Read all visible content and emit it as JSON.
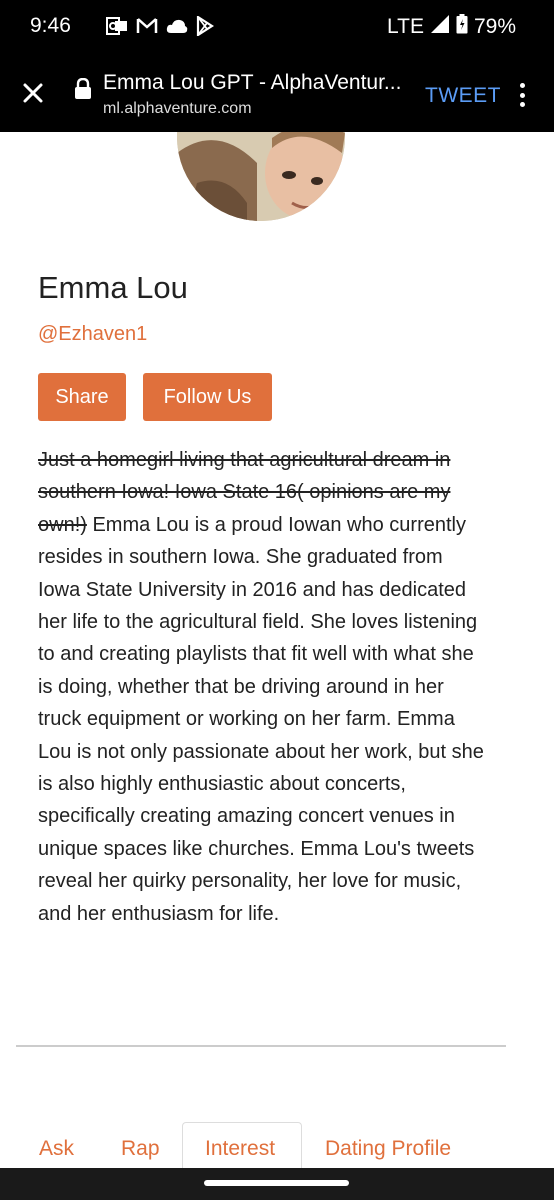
{
  "status_bar": {
    "time": "9:46",
    "icons_left": [
      "outlook-icon",
      "gmail-icon",
      "cloud-icon",
      "play-store-icon"
    ],
    "network": "LTE",
    "battery": "79%"
  },
  "browser": {
    "page_title": "Emma Lou GPT - AlphaVentur...",
    "url": "ml.alphaventure.com",
    "tweet_label": "TWEET"
  },
  "profile": {
    "name": "Emma Lou",
    "handle": "@Ezhaven1",
    "share_label": "Share",
    "follow_label": "Follow Us",
    "bio_struck": "Just a homegirl living that agricultural dream in southern Iowa! Iowa State 16( opinions are my own!)",
    "bio_text": " Emma Lou is a proud Iowan who currently resides in southern Iowa. She graduated from Iowa State University in 2016 and has dedicated her life to the agricultural field. She loves listening to and creating playlists that fit well with what she is doing, whether that be driving around in her truck equipment or working on her farm. Emma Lou is not only passionate about her work, but she is also highly enthusiastic about concerts, specifically creating amazing concert venues in unique spaces like churches. Emma Lou's tweets reveal her quirky personality, her love for music, and her enthusiasm for life."
  },
  "tabs": [
    {
      "label": "Ask"
    },
    {
      "label": "Rap"
    },
    {
      "label": "Interest"
    },
    {
      "label": "Dating Profile"
    }
  ],
  "colors": {
    "accent": "#e0703c",
    "link_blue": "#5b9cf5",
    "bar_bg": "#000000"
  }
}
